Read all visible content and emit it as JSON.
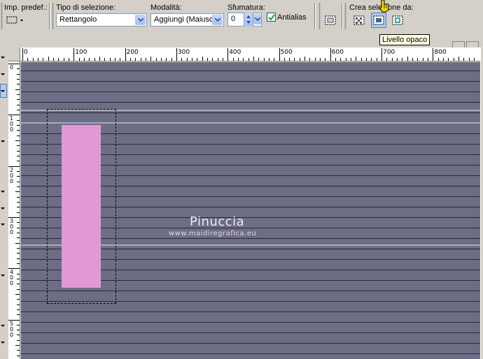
{
  "toolbar": {
    "preset_label": "Imp. predef.:",
    "selection_type_label": "Tipo di selezione:",
    "selection_type_value": "Rettangolo",
    "mode_label": "Modalità:",
    "mode_value": "Aggiungi (Maiusc)",
    "feather_label": "Sfumatura:",
    "feather_value": "0",
    "antialias_label": "Antialias",
    "antialias_checked": true,
    "create_selection_label": "Crea selezione da:",
    "tooltip": "Livello opaco"
  },
  "ruler": {
    "h_labels": [
      "0",
      "100",
      "200",
      "300",
      "400",
      "500",
      "600",
      "700",
      "800"
    ],
    "v_labels": [
      [
        "0"
      ],
      [
        "1",
        "0",
        "0"
      ],
      [
        "2",
        "0",
        "0"
      ],
      [
        "3",
        "0",
        "0"
      ],
      [
        "4",
        "0",
        "0"
      ],
      [
        "5",
        "0",
        "0"
      ]
    ]
  },
  "watermark": {
    "title": "Pinuccia",
    "url": "www.maidiregrafica.eu"
  },
  "colors": {
    "canvas": "#6d6d86",
    "shape": "#e298d6",
    "accent": "#4c78c8"
  }
}
